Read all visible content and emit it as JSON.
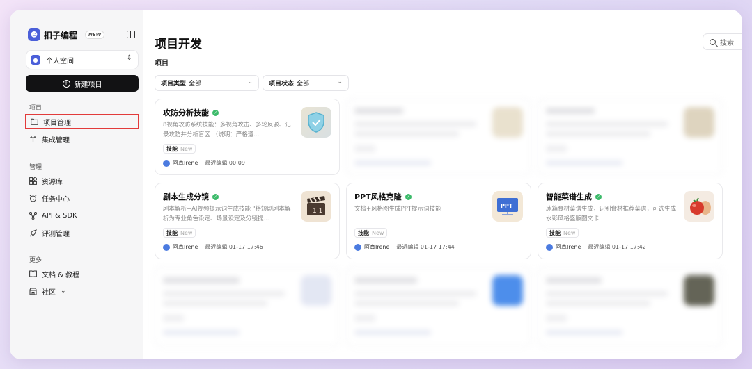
{
  "sidebar": {
    "brand": {
      "name": "扣子编程",
      "badge": "NEW",
      "logo_icon": "bot-logo-icon"
    },
    "space": {
      "label": "个人空间"
    },
    "new_project_label": "新建项目",
    "sections": [
      {
        "title": "项目",
        "items": [
          {
            "label": "项目管理",
            "icon": "folder-icon",
            "active": true
          },
          {
            "label": "集成管理",
            "icon": "plug-icon"
          }
        ]
      },
      {
        "title": "管理",
        "items": [
          {
            "label": "资源库",
            "icon": "grid-icon"
          },
          {
            "label": "任务中心",
            "icon": "alarm-icon"
          },
          {
            "label": "API & SDK",
            "icon": "api-icon"
          },
          {
            "label": "评测管理",
            "icon": "rocket-icon"
          }
        ]
      },
      {
        "title": "更多",
        "items": [
          {
            "label": "文档 & 教程",
            "icon": "book-icon"
          },
          {
            "label": "社区",
            "icon": "store-icon"
          }
        ]
      }
    ]
  },
  "main": {
    "title": "项目开发",
    "search_placeholder": "搜索",
    "subtitle": "项目",
    "filters": [
      {
        "label": "项目类型",
        "value": "全部"
      },
      {
        "label": "项目状态",
        "value": "全部"
      }
    ],
    "cards": [
      {
        "title": "攻防分析技能",
        "desc": "8视角攻防系统技能：多视角攻击、多轮反驳、记录攻防并分析盲区 （说明：严格遵...",
        "tag": "技能",
        "tag_status": "New",
        "author": "阿真Irene",
        "edited": "最近编辑 00:09"
      },
      {
        "title": "剧本生成分镜",
        "desc": "剧本解析+AI视频提示词生成技能 \"将短剧剧本解析为专业角色设定、场景设定及分镜提...",
        "tag": "技能",
        "tag_status": "New",
        "author": "阿真Irene",
        "edited": "最近编辑 01-17 17:46"
      },
      {
        "title": "PPT风格克隆",
        "desc": "文档+风格图生成PPT提示词技能",
        "tag": "技能",
        "tag_status": "New",
        "author": "阿真Irene",
        "edited": "最近编辑 01-17 17:44"
      },
      {
        "title": "智能菜谱生成",
        "desc": "冰箱食材菜谱生成，识别食材推荐菜谱，可选生成水彩风格竖版图文卡",
        "tag": "技能",
        "tag_status": "New",
        "author": "阿真Irene",
        "edited": "最近编辑 01-17 17:42"
      }
    ],
    "thumb_text": "PPT"
  }
}
